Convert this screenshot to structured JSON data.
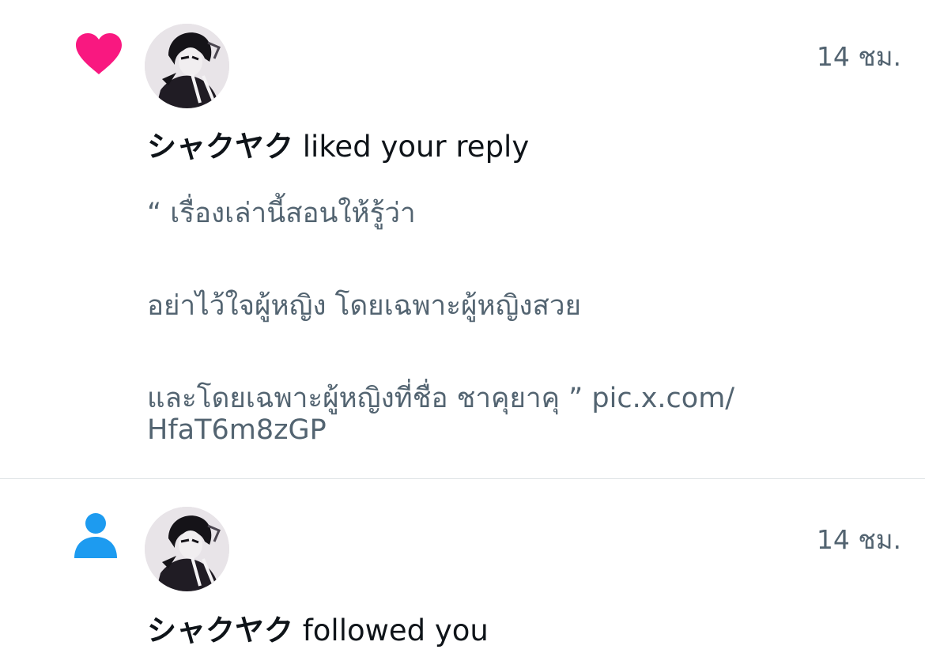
{
  "notifications": [
    {
      "type": "like",
      "time": "14 ชม.",
      "actor": "シャクヤク",
      "action": "liked your reply",
      "preview": {
        "line1": "“ เรื่องเล่านี้สอนให้รู้ว่า",
        "line2": "อย่าไว้ใจผู้หญิง โดยเฉพาะผู้หญิงสวย",
        "line3": "และโดยเฉพาะผู้หญิงที่ชื่อ ชาคุยาคุ ” pic.x.com/",
        "line4": "HfaT6m8zGP"
      },
      "icon": "heart-icon",
      "icon_color": "#f91880"
    },
    {
      "type": "follow",
      "time": "14 ชม.",
      "actor": "シャクヤク",
      "action": "followed you",
      "icon": "person-icon",
      "icon_color": "#1d9bf0"
    }
  ]
}
